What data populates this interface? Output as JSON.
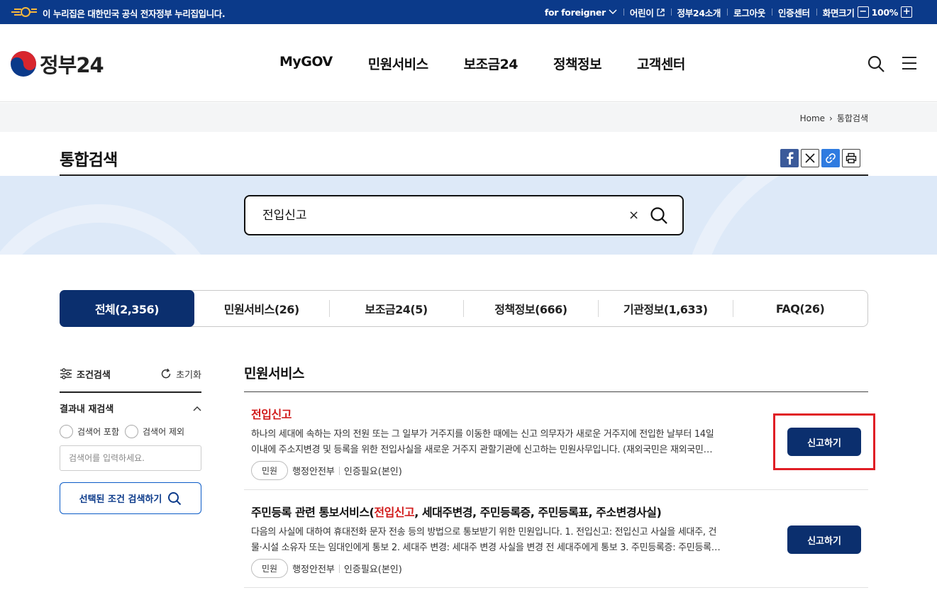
{
  "topbar": {
    "notice": "이 누리집은 대한민국 공식 전자정부 누리집입니다.",
    "links": [
      {
        "label": "for foreigner"
      },
      {
        "label": "어린이"
      },
      {
        "label": "정부24소개"
      },
      {
        "label": "로그아웃"
      },
      {
        "label": "인증센터"
      },
      {
        "label": "화면크기"
      }
    ],
    "zoom_minus": "−",
    "zoom_value": "100%",
    "zoom_plus": "+"
  },
  "header": {
    "logo_text": "정부24",
    "nav": [
      "MyGOV",
      "민원서비스",
      "보조금24",
      "정책정보",
      "고객센터"
    ]
  },
  "breadcrumb": {
    "home": "Home",
    "separator": "›",
    "current": "통합검색"
  },
  "page": {
    "title": "통합검색"
  },
  "search": {
    "query": "전입신고",
    "clear": "×"
  },
  "tabs": [
    {
      "label": "전체(2,356)",
      "active": true
    },
    {
      "label": "민원서비스(26)"
    },
    {
      "label": "보조금24(5)"
    },
    {
      "label": "정책정보(666)"
    },
    {
      "label": "기관정보(1,633)"
    },
    {
      "label": "FAQ(26)"
    }
  ],
  "filter": {
    "title": "조건검색",
    "reset": "초기화",
    "subsection": "결과내 재검색",
    "include": "검색어 포함",
    "exclude": "검색어 제외",
    "placeholder": "검색어를 입력하세요.",
    "submit": "선택된 조건 검색하기"
  },
  "results": {
    "section_title": "민원서비스",
    "items": [
      {
        "title_hl": "전입신고",
        "title_pre": "",
        "title_post": "",
        "desc_line1": "하나의 세대에 속하는 자의 전원 또는 그 일부가 거주지를 이동한 때에는 신고 의무자가 새로운 거주지에 전입한 날부터 14일",
        "desc_line2": "이내에 주소지변경 및 등록을 위한 전입사실을 새로운 거주지 관할기관에 신고하는 민원사무입니다. (재외국민은 재외국민…",
        "badge": "민원",
        "agency": "행정안전부",
        "auth": "인증필요(본인)",
        "action": "신고하기"
      },
      {
        "title_pre": "주민등록 관련 통보서비스(",
        "title_hl": "전입신고",
        "title_post": ", 세대주변경, 주민등록증, 주민등록표, 주소변경사실)",
        "desc_line1": "다음의 사실에 대하여 휴대전화 문자 전송 등의 방법으로 통보받기 위한 민원입니다. 1. 전입신고: 전입신고 사실을 세대주, 건",
        "desc_line2": "물·시설 소유자 또는 임대인에게 통보 2. 세대주 변경: 세대주 변경 사실을 변경 전 세대주에게 통보 3. 주민등록증: 주민등록…",
        "badge": "민원",
        "agency": "행정안전부",
        "auth": "인증필요(본인)",
        "action": "신고하기"
      }
    ]
  },
  "colors": {
    "brand_navy": "#0b2f6e",
    "topbar_blue": "#0b3a8a",
    "highlight_red": "#d11a1a",
    "hero_bg": "#dde9f8"
  }
}
